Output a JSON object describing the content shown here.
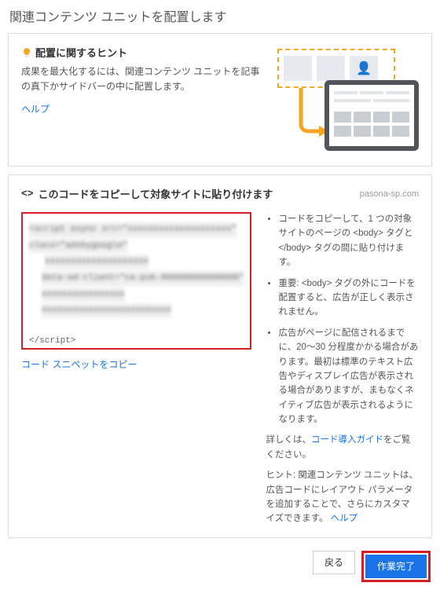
{
  "page_title": "関連コンテンツ ユニットを配置します",
  "hint": {
    "heading": "配置に関するヒント",
    "description": "成果を最大化するには、関連コンテンツ ユニットを記事の真下かサイドバーの中に配置します。",
    "help_link": "ヘルプ"
  },
  "copy_section": {
    "title": "このコードをコピーして対象サイトに貼り付けます",
    "domain": "pasona-sp.com",
    "code": {
      "line1": "<script async src=\"xxxxxxxxxxxxxxxxxxxx\"",
      "line2": "class=\"adsbygoogle\"",
      "line3": "xxxxxxxxxxxxxxxxxxxx",
      "line4": "data-ad-client=\"ca-pub-000000000000000\"",
      "line5": "xxxxxxxxxxxxxxxx",
      "line6": "xxxxxxxxxxxxxxxxxxxxxxxxx",
      "line7": "</script>"
    },
    "copy_link": "コード スニペットをコピー",
    "info": {
      "bullet1_part1": "コードをコピーして、1 つの対象サイトのページの ",
      "bullet1_tag1": "<body>",
      "bullet1_mid": " タグと ",
      "bullet1_tag2": "</body>",
      "bullet1_end": " タグの間に貼り付けます。",
      "bullet2_part1": "重要: ",
      "bullet2_tag": "<body>",
      "bullet2_end": " タグの外にコードを配置すると、広告が正しく表示されません。",
      "bullet3": "広告がページに配信されるまでに、20～30 分程度かかる場合があります。最初は標準のテキスト広告やディスプレイ広告が表示される場合がありますが、まもなくネイティブ広告が表示されるようになります。",
      "more_prefix": "詳しくは、",
      "more_link": "コード導入ガイド",
      "more_suffix": "をご覧ください。",
      "hint_text": "ヒント: 関連コンテンツ ユニットは、広告コードにレイアウト パラメータを追加することで、さらにカスタマイズできます。",
      "hint_link": "ヘルプ"
    }
  },
  "footer": {
    "back": "戻る",
    "submit": "作業完了"
  }
}
